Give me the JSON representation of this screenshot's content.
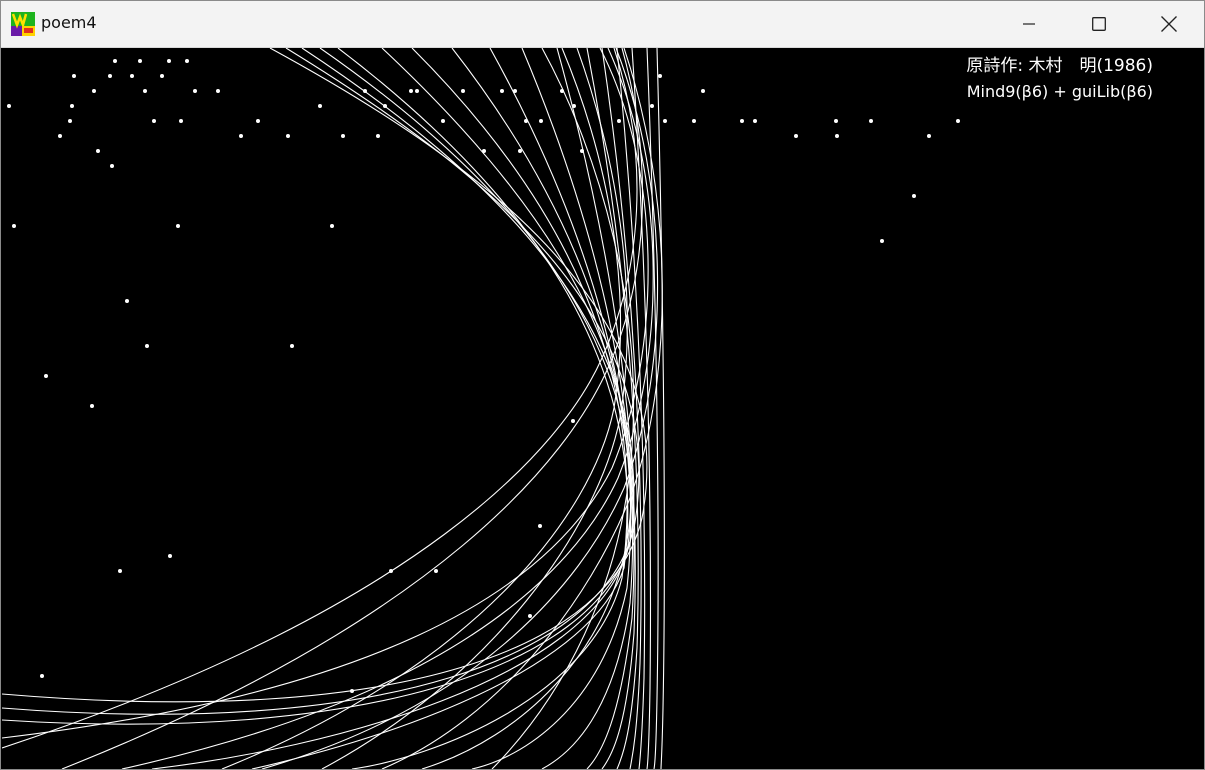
{
  "window": {
    "title": "poem4",
    "app_icon": "poem4-app-icon",
    "controls": {
      "minimize_icon": "minimize-icon",
      "maximize_icon": "maximize-icon",
      "close_icon": "close-icon"
    }
  },
  "canvas": {
    "background": "#000000",
    "foreground": "#ffffff",
    "credits": {
      "original": "原詩作: 木村　明(1986)",
      "software": "Mind9(β6) + guiLib(β6)"
    }
  }
}
